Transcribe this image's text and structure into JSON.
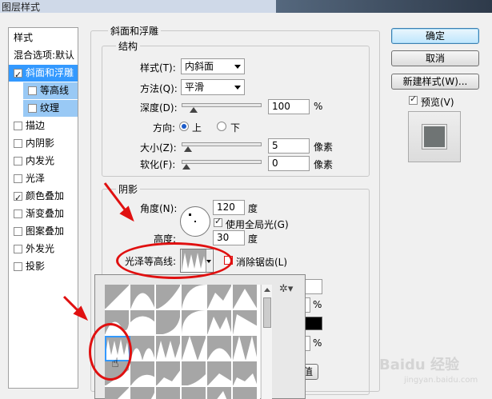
{
  "window": {
    "title": "图层样式"
  },
  "left_panel": {
    "items": [
      {
        "label": "样式",
        "checkbox": false,
        "checked": false,
        "state": "header"
      },
      {
        "label": "混合选项:默认",
        "checkbox": false,
        "checked": false,
        "state": "normal"
      },
      {
        "label": "斜面和浮雕",
        "checkbox": true,
        "checked": true,
        "state": "selected"
      },
      {
        "label": "等高线",
        "checkbox": true,
        "checked": false,
        "state": "sub"
      },
      {
        "label": "纹理",
        "checkbox": true,
        "checked": false,
        "state": "sub"
      },
      {
        "label": "描边",
        "checkbox": true,
        "checked": false,
        "state": "normal"
      },
      {
        "label": "内阴影",
        "checkbox": true,
        "checked": false,
        "state": "normal"
      },
      {
        "label": "内发光",
        "checkbox": true,
        "checked": false,
        "state": "normal"
      },
      {
        "label": "光泽",
        "checkbox": true,
        "checked": false,
        "state": "normal"
      },
      {
        "label": "颜色叠加",
        "checkbox": true,
        "checked": true,
        "state": "normal"
      },
      {
        "label": "渐变叠加",
        "checkbox": true,
        "checked": false,
        "state": "normal"
      },
      {
        "label": "图案叠加",
        "checkbox": true,
        "checked": false,
        "state": "normal"
      },
      {
        "label": "外发光",
        "checkbox": true,
        "checked": false,
        "state": "normal"
      },
      {
        "label": "投影",
        "checkbox": true,
        "checked": false,
        "state": "normal"
      }
    ]
  },
  "bevel": {
    "section_title": "斜面和浮雕",
    "structure": {
      "title": "结构",
      "style_label": "样式(T):",
      "style_value": "内斜面",
      "technique_label": "方法(Q):",
      "technique_value": "平滑",
      "depth_label": "深度(D):",
      "depth_value": "100",
      "depth_unit": "%",
      "depth_slider": 0.1,
      "direction_label": "方向:",
      "direction_up": "上",
      "direction_down": "下",
      "size_label": "大小(Z):",
      "size_value": "5",
      "size_unit": "像素",
      "size_slider": 0.02,
      "soften_label": "软化(F):",
      "soften_value": "0",
      "soften_unit": "像素",
      "soften_slider": 0.0
    },
    "shading": {
      "title": "阴影",
      "angle_label": "角度(N):",
      "angle_value": "120",
      "angle_unit": "度",
      "global_light_label": "使用全局光(G)",
      "altitude_label": "高度:",
      "altitude_value": "30",
      "altitude_unit": "度",
      "gloss_contour_label": "光泽等高线:",
      "antialias_label": "消除锯齿(L)",
      "partial_pct_1": "%",
      "partial_pct_2": "%",
      "partial_button": "值"
    }
  },
  "buttons": {
    "ok": "确定",
    "cancel": "取消",
    "new_style": "新建样式(W)...",
    "preview_label": "预览(V)"
  },
  "watermark": {
    "text": "Baidu 经验",
    "sub": "jingyan.baidu.com"
  },
  "colors": {
    "accent": "#3399ff",
    "annotation": "#e01010",
    "swatch": "#6f7474"
  }
}
